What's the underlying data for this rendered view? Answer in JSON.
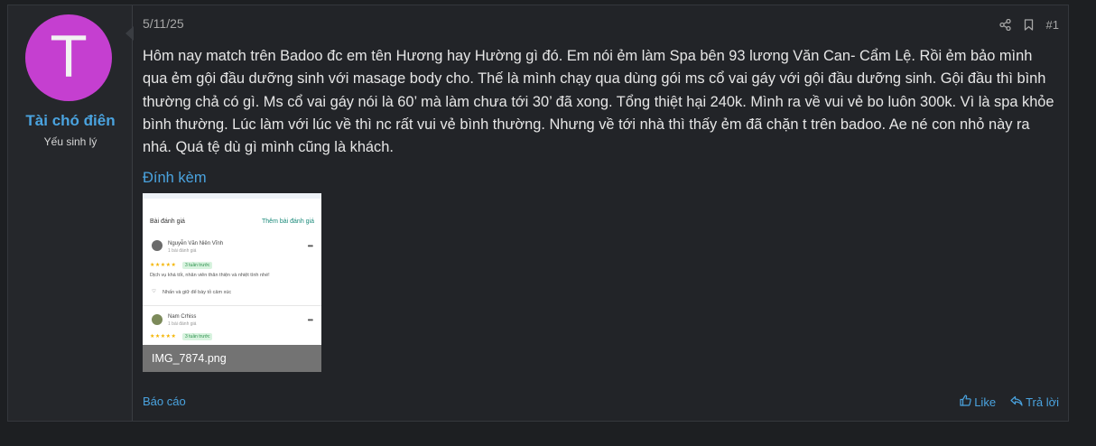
{
  "user": {
    "avatar_letter": "T",
    "avatar_color": "#c53fd0",
    "name": "Tài chó điên",
    "title": "Yếu sinh lý"
  },
  "post": {
    "date": "5/11/25",
    "number": "#1",
    "body": "Hôm nay match trên Badoo đc em tên Hương hay Hường gì đó. Em nói ẻm làm Spa bên 93 lương Văn Can- Cẩm Lệ. Rồi ẻm bảo mình qua ẻm gội đầu dưỡng sinh với masage body cho. Thế là mình chạy qua dùng gói ms cổ vai gáy với gội đầu dưỡng sinh. Gội đầu thì bình thường chả có gì. Ms cổ vai gáy nói là 60’ mà làm chưa tới 30’ đã xong. Tổng thiệt hại 240k. Mình ra về vui vẻ bo luôn 300k. Vì là spa khỏe bình thường. Lúc làm với lúc về thì nc rất vui vẻ bình thường. Nhưng về tới nhà thì thấy ẻm đã chặn t trên badoo. Ae né con nhỏ này ra nhá. Quá tệ dù gì mình cũng là khách.",
    "attachments_label": "Đính kèm",
    "attachment": {
      "filename": "IMG_7874.png",
      "preview": {
        "header": "Bài đánh giá",
        "header_link": "Thêm bài đánh giá",
        "reviews": [
          {
            "name": "Nguyễn Văn Niên Vĩnh",
            "sub": "1 bài đánh giá",
            "stars": "★★★★★",
            "badge": "3 tuần trước",
            "text": "Dịch vụ khá tốt, nhân viên thân thiện và nhiệt tình nhé!",
            "react": "Nhấn và giữ để bày tỏ cảm xúc"
          },
          {
            "name": "Nam Crhiss",
            "sub": "1 bài đánh giá",
            "stars": "★★★★★",
            "badge": "3 tuần trước"
          }
        ]
      }
    },
    "report_label": "Báo cáo",
    "like_label": "Like",
    "reply_label": "Trả lời"
  },
  "icons": {
    "share": "share-icon",
    "bookmark": "bookmark-icon",
    "like": "thumbs-up-icon",
    "reply": "reply-icon"
  },
  "colors": {
    "accent": "#4aa3df",
    "background": "#1d1f22",
    "panel": "#222428"
  }
}
